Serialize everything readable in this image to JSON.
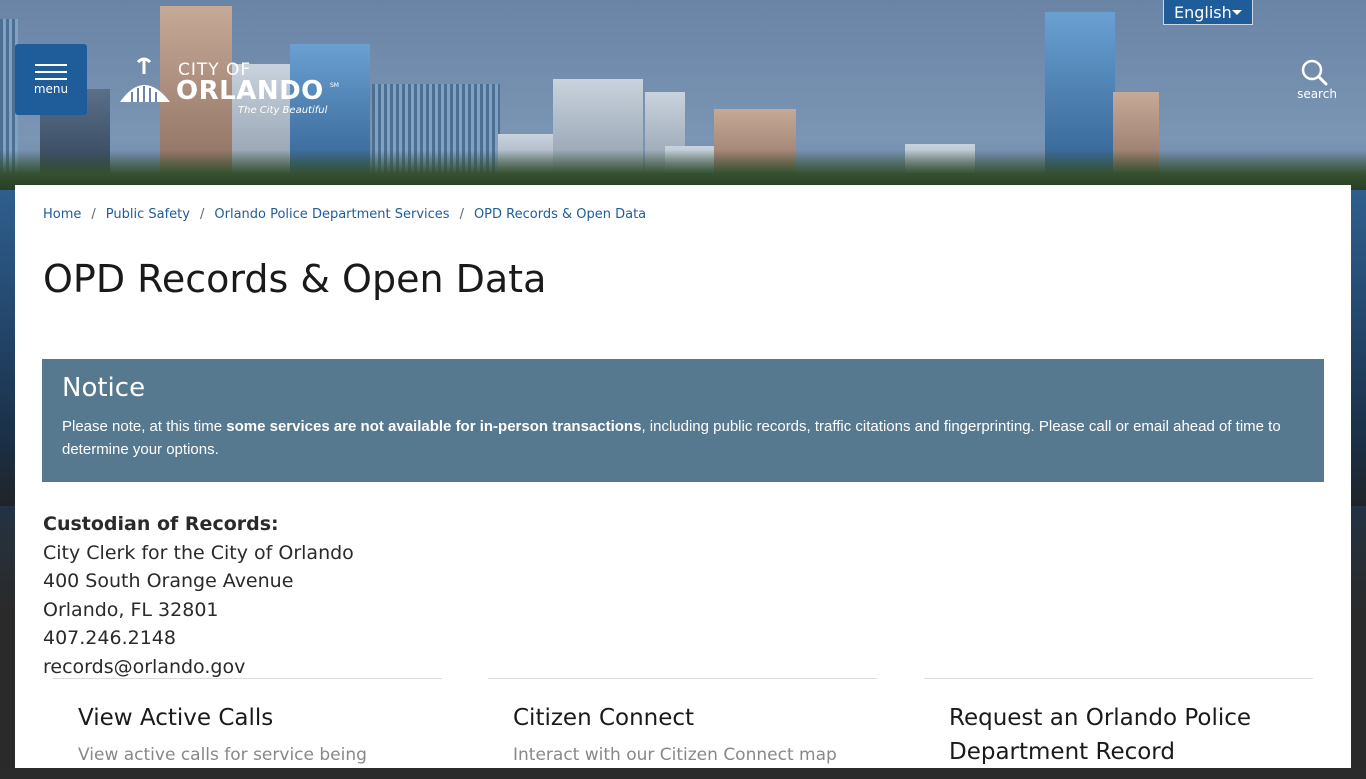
{
  "header": {
    "language": "English",
    "menu_label": "menu",
    "logo": {
      "city_of": "CITY OF",
      "orlando": "ORLANDO",
      "sm": "SM",
      "tagline": "The City Beautiful"
    },
    "search_label": "search"
  },
  "breadcrumb": [
    "Home",
    "Public Safety",
    "Orlando Police Department Services",
    "OPD Records & Open Data"
  ],
  "page_title": "OPD Records & Open Data",
  "notice": {
    "title": "Notice",
    "text_before": "Please note, at this time ",
    "text_bold": "some services are not available for in-person transactions",
    "text_after": ", including public records, traffic citations and fingerprinting. Please call or email ahead of time to determine your options."
  },
  "custodian": {
    "label": "Custodian of Records:",
    "name": "City Clerk for the City of Orlando",
    "street": "400 South Orange Avenue",
    "city": "Orlando, FL 32801",
    "phone": "407.246.2148",
    "email": "records@orlando.gov"
  },
  "cards": [
    {
      "title": "View Active Calls",
      "desc": "View active calls for service being"
    },
    {
      "title": "Citizen Connect",
      "desc": "Interact with our Citizen Connect map"
    },
    {
      "title": "Request an Orlando Police Department Record",
      "desc": ""
    }
  ],
  "colors": {
    "brand_blue": "#1f5c9a",
    "notice_bg": "#56798f"
  }
}
